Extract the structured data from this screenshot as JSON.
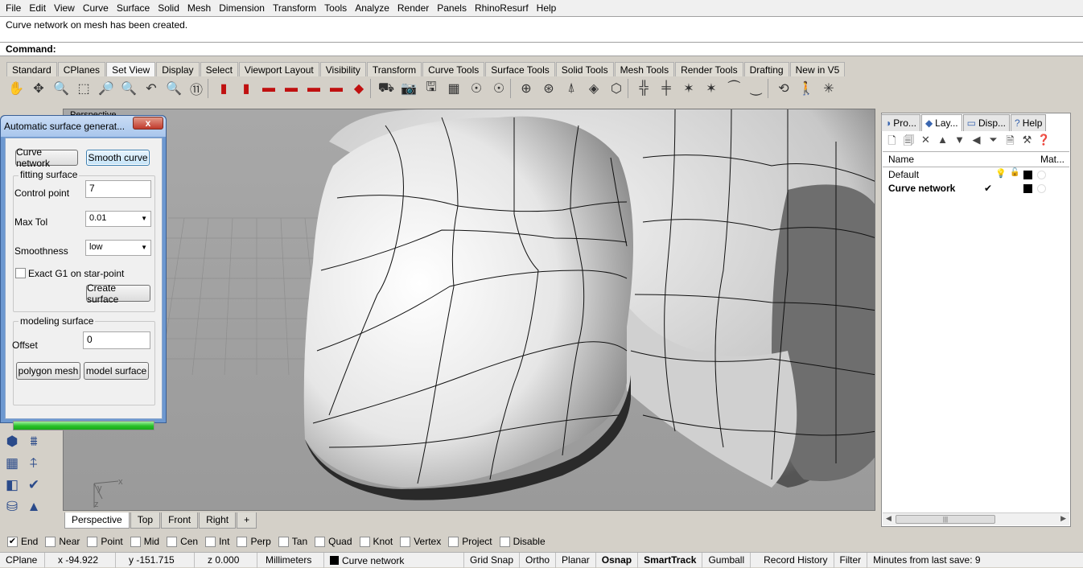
{
  "menu": [
    "File",
    "Edit",
    "View",
    "Curve",
    "Surface",
    "Solid",
    "Mesh",
    "Dimension",
    "Transform",
    "Tools",
    "Analyze",
    "Render",
    "Panels",
    "RhinoResurf",
    "Help"
  ],
  "command_history": "Curve network on mesh has been created.",
  "command_prompt": "Command:",
  "toolbar_tabs": [
    {
      "label": "Standard",
      "active": false
    },
    {
      "label": "CPlanes",
      "active": false
    },
    {
      "label": "Set View",
      "active": true
    },
    {
      "label": "Display",
      "active": false
    },
    {
      "label": "Select",
      "active": false
    },
    {
      "label": "Viewport Layout",
      "active": false
    },
    {
      "label": "Visibility",
      "active": false
    },
    {
      "label": "Transform",
      "active": false
    },
    {
      "label": "Curve Tools",
      "active": false
    },
    {
      "label": "Surface Tools",
      "active": false
    },
    {
      "label": "Solid Tools",
      "active": false
    },
    {
      "label": "Mesh Tools",
      "active": false
    },
    {
      "label": "Render Tools",
      "active": false
    },
    {
      "label": "Drafting",
      "active": false
    },
    {
      "label": "New in V5",
      "active": false
    }
  ],
  "toolbar_icons": [
    {
      "name": "pan-icon",
      "glyph": "✋"
    },
    {
      "name": "rotate-view-icon",
      "glyph": "✥"
    },
    {
      "name": "zoom-dynamic-icon",
      "glyph": "🔍"
    },
    {
      "name": "zoom-window-icon",
      "glyph": "⬚"
    },
    {
      "name": "zoom-extents-icon",
      "glyph": "🔎"
    },
    {
      "name": "zoom-selected-icon",
      "glyph": "🔍"
    },
    {
      "name": "undo-view-icon",
      "glyph": "↶"
    },
    {
      "name": "zoom-out-icon",
      "glyph": "🔍"
    },
    {
      "name": "zoom-one-to-one-icon",
      "glyph": "⑪"
    },
    {
      "name": "sep",
      "glyph": ""
    },
    {
      "name": "view-front-car-icon",
      "glyph": "▮",
      "red": true
    },
    {
      "name": "view-back-car-icon",
      "glyph": "▮",
      "red": true
    },
    {
      "name": "view-top-car-icon",
      "glyph": "▬",
      "red": true
    },
    {
      "name": "view-side-car-icon",
      "glyph": "▬",
      "red": true
    },
    {
      "name": "view-left-car-icon",
      "glyph": "▬",
      "red": true
    },
    {
      "name": "view-right-car-icon",
      "glyph": "▬",
      "red": true
    },
    {
      "name": "view-perspective-car-icon",
      "glyph": "◆",
      "red": true
    },
    {
      "name": "sep",
      "glyph": ""
    },
    {
      "name": "camera-target-icon",
      "glyph": "⛟"
    },
    {
      "name": "camera-icon",
      "glyph": "📷"
    },
    {
      "name": "named-views-icon",
      "glyph": "🖫"
    },
    {
      "name": "viewports-icon",
      "glyph": "▦"
    },
    {
      "name": "light-icon",
      "glyph": "☉"
    },
    {
      "name": "lights-icon",
      "glyph": "☉"
    },
    {
      "name": "sep",
      "glyph": ""
    },
    {
      "name": "target-icon",
      "glyph": "⊕"
    },
    {
      "name": "target-yellow-icon",
      "glyph": "⊛"
    },
    {
      "name": "elevator-icon",
      "glyph": "⍋"
    },
    {
      "name": "cplane-icon",
      "glyph": "◈"
    },
    {
      "name": "cube-view-icon",
      "glyph": "⬡"
    },
    {
      "name": "sep",
      "glyph": ""
    },
    {
      "name": "cplane-origin-icon",
      "glyph": "╬"
    },
    {
      "name": "cplane-elevation-icon",
      "glyph": "╪"
    },
    {
      "name": "cplane-3pt-icon",
      "glyph": "✶"
    },
    {
      "name": "cplane-object-icon",
      "glyph": "✶"
    },
    {
      "name": "cplane-view-icon",
      "glyph": "⏜"
    },
    {
      "name": "cplane-curve-icon",
      "glyph": "⏝"
    },
    {
      "name": "sep",
      "glyph": ""
    },
    {
      "name": "flip-cplane-icon",
      "glyph": "⟲"
    },
    {
      "name": "walkabout-icon",
      "glyph": "🚶"
    },
    {
      "name": "sun-icon",
      "glyph": "✳"
    }
  ],
  "viewport": {
    "label": "Perspective"
  },
  "viewport_tabs": [
    {
      "label": "Perspective",
      "active": true
    },
    {
      "label": "Top",
      "active": false
    },
    {
      "label": "Front",
      "active": false
    },
    {
      "label": "Right",
      "active": false
    },
    {
      "label": "+",
      "active": false
    }
  ],
  "axis": {
    "x": "x",
    "y": "y",
    "z": "z"
  },
  "dialog": {
    "title": "Automatic surface generat...",
    "close": "x",
    "curve_network_button": "Curve network",
    "smooth_curve_button": "Smooth curve",
    "fitting_group": "fitting surface",
    "control_point_label": "Control point",
    "control_point_value": "7",
    "max_tol_label": "Max Tol",
    "max_tol_value": "0.01",
    "smoothness_label": "Smoothness",
    "smoothness_value": "low",
    "exact_g1_label": "Exact G1 on star-point",
    "exact_g1_checked": false,
    "create_surface_button": "Create surface",
    "modeling_group": "modeling surface",
    "offset_label": "Offset",
    "offset_value": "0",
    "polygon_mesh_button": "polygon mesh",
    "model_surface_button": "model surface",
    "progress": 1.0
  },
  "right_panel": {
    "tabs": [
      {
        "label": "Pro...",
        "icon": "properties-icon",
        "glyph": "◑",
        "active": false
      },
      {
        "label": "Lay...",
        "icon": "layers-icon",
        "glyph": "◆",
        "active": true
      },
      {
        "label": "Disp...",
        "icon": "display-icon",
        "glyph": "▭",
        "active": false
      },
      {
        "label": "Help",
        "icon": "help-icon",
        "glyph": "?",
        "active": false
      }
    ],
    "tools": [
      {
        "name": "new-layer-icon",
        "glyph": "🗋"
      },
      {
        "name": "new-sublayer-icon",
        "glyph": "🗐"
      },
      {
        "name": "delete-layer-icon",
        "glyph": "✕"
      },
      {
        "name": "move-up-icon",
        "glyph": "▲"
      },
      {
        "name": "move-down-icon",
        "glyph": "▼"
      },
      {
        "name": "move-parent-icon",
        "glyph": "◀"
      },
      {
        "name": "filter-icon",
        "glyph": "⏷"
      },
      {
        "name": "layer-states-icon",
        "glyph": "🗎"
      },
      {
        "name": "tools-icon",
        "glyph": "⚒"
      },
      {
        "name": "help-icon",
        "glyph": "❓"
      }
    ],
    "header_name": "Name",
    "header_material": "Mat...",
    "layers": [
      {
        "name": "Default",
        "current": false,
        "bold": false
      },
      {
        "name": "Curve network",
        "current": true,
        "bold": true
      }
    ],
    "current_mark": "✔"
  },
  "osnaps": [
    {
      "label": "End",
      "checked": true
    },
    {
      "label": "Near",
      "checked": false
    },
    {
      "label": "Point",
      "checked": false
    },
    {
      "label": "Mid",
      "checked": false
    },
    {
      "label": "Cen",
      "checked": false
    },
    {
      "label": "Int",
      "checked": false
    },
    {
      "label": "Perp",
      "checked": false
    },
    {
      "label": "Tan",
      "checked": false
    },
    {
      "label": "Quad",
      "checked": false
    },
    {
      "label": "Knot",
      "checked": false
    },
    {
      "label": "Vertex",
      "checked": false
    },
    {
      "label": "Project",
      "checked": false
    },
    {
      "label": "Disable",
      "checked": false
    }
  ],
  "status": {
    "cplane": "CPlane",
    "x": "x -94.922",
    "y": "y -151.715",
    "z": "z 0.000",
    "units": "Millimeters",
    "layer": "Curve network",
    "grid_snap": "Grid Snap",
    "ortho": "Ortho",
    "planar": "Planar",
    "osnap": "Osnap",
    "smarttrack": "SmartTrack",
    "gumball": "Gumball",
    "record_history": "Record History",
    "filter": "Filter",
    "save_info": "Minutes from last save: 9"
  },
  "colors": {
    "accent": "#3c7fb1",
    "dialog_frame": "#6d98d0",
    "progress": "#27c027"
  }
}
